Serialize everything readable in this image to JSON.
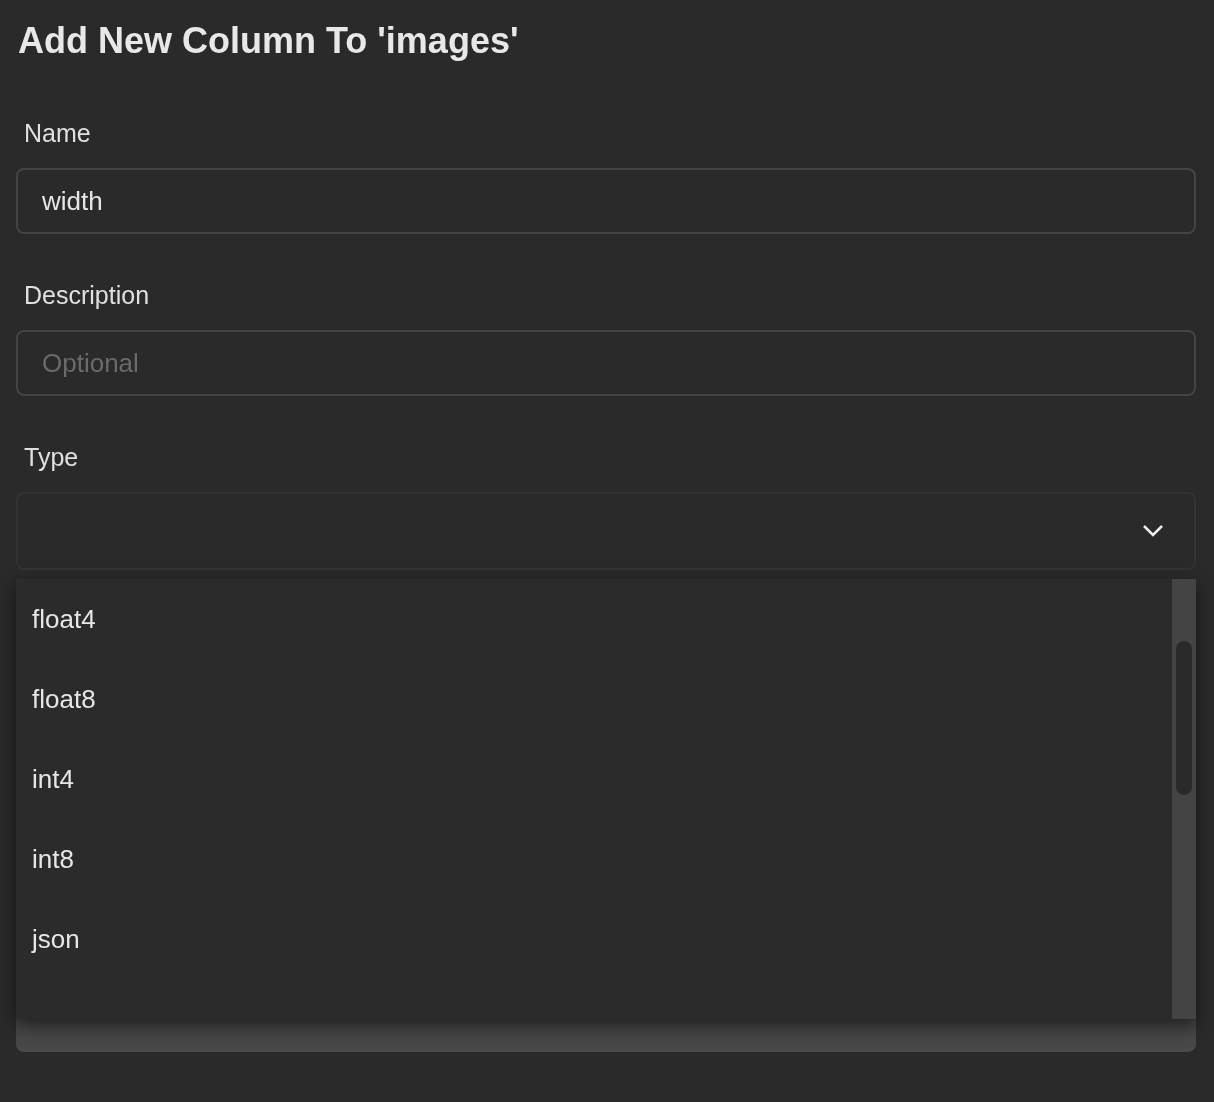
{
  "title": "Add New Column To 'images'",
  "fields": [
    {
      "label": "Name",
      "value": "width"
    },
    {
      "label": "Description",
      "placeholder": "Optional"
    }
  ],
  "type_field": {
    "label": "Type",
    "expanded": true
  },
  "type_options": [
    {
      "label": "float4"
    },
    {
      "label": "float8"
    },
    {
      "label": "int4"
    },
    {
      "label": "int8"
    },
    {
      "label": "json"
    }
  ]
}
